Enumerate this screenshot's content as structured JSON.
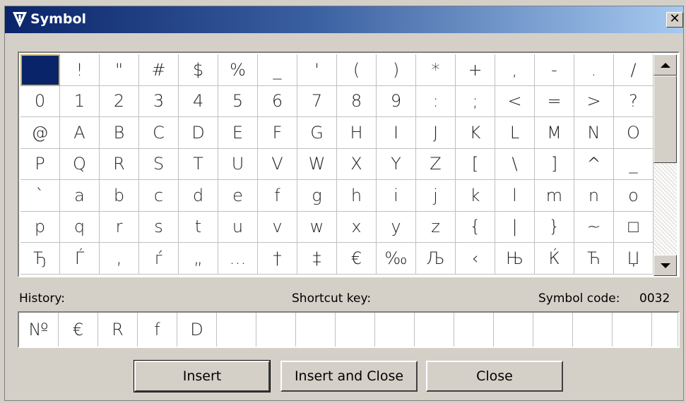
{
  "window": {
    "title": "Symbol",
    "close_label": "✕"
  },
  "grid": {
    "rows": [
      [
        " ",
        "!",
        "\"",
        "#",
        "$",
        "%",
        "_",
        "'",
        "(",
        ")",
        "*",
        "+",
        ",",
        "-",
        ".",
        "/"
      ],
      [
        "0",
        "1",
        "2",
        "3",
        "4",
        "5",
        "6",
        "7",
        "8",
        "9",
        ":",
        ";",
        "<",
        "=",
        ">",
        "?"
      ],
      [
        "@",
        "A",
        "B",
        "C",
        "D",
        "E",
        "F",
        "G",
        "H",
        "I",
        "J",
        "K",
        "L",
        "M",
        "N",
        "O"
      ],
      [
        "P",
        "Q",
        "R",
        "S",
        "T",
        "U",
        "V",
        "W",
        "X",
        "Y",
        "Z",
        "[",
        "\\",
        "]",
        "^",
        "_"
      ],
      [
        "`",
        "a",
        "b",
        "c",
        "d",
        "e",
        "f",
        "g",
        "h",
        "i",
        "j",
        "k",
        "l",
        "m",
        "n",
        "o"
      ],
      [
        "p",
        "q",
        "r",
        "s",
        "t",
        "u",
        "v",
        "w",
        "x",
        "y",
        "z",
        "{",
        "|",
        "}",
        "~",
        "□"
      ],
      [
        "Ђ",
        "Ѓ",
        "‚",
        "ѓ",
        "„",
        "…",
        "†",
        "‡",
        "€",
        "‰",
        "Љ",
        "‹",
        "Њ",
        "Ќ",
        "Ћ",
        "Џ"
      ]
    ],
    "selected_index": 0
  },
  "info": {
    "history_label": "History:",
    "shortcut_label": "Shortcut key:",
    "symbol_code_label": "Symbol code:",
    "symbol_code_value": "0032"
  },
  "history": {
    "items": [
      "№",
      "€",
      "R",
      "f",
      "D",
      "",
      "",
      "",
      "",
      "",
      "",
      "",
      "",
      "",
      "",
      "",
      ""
    ]
  },
  "buttons": {
    "insert": "Insert",
    "insert_and_close": "Insert and Close",
    "close": "Close"
  }
}
